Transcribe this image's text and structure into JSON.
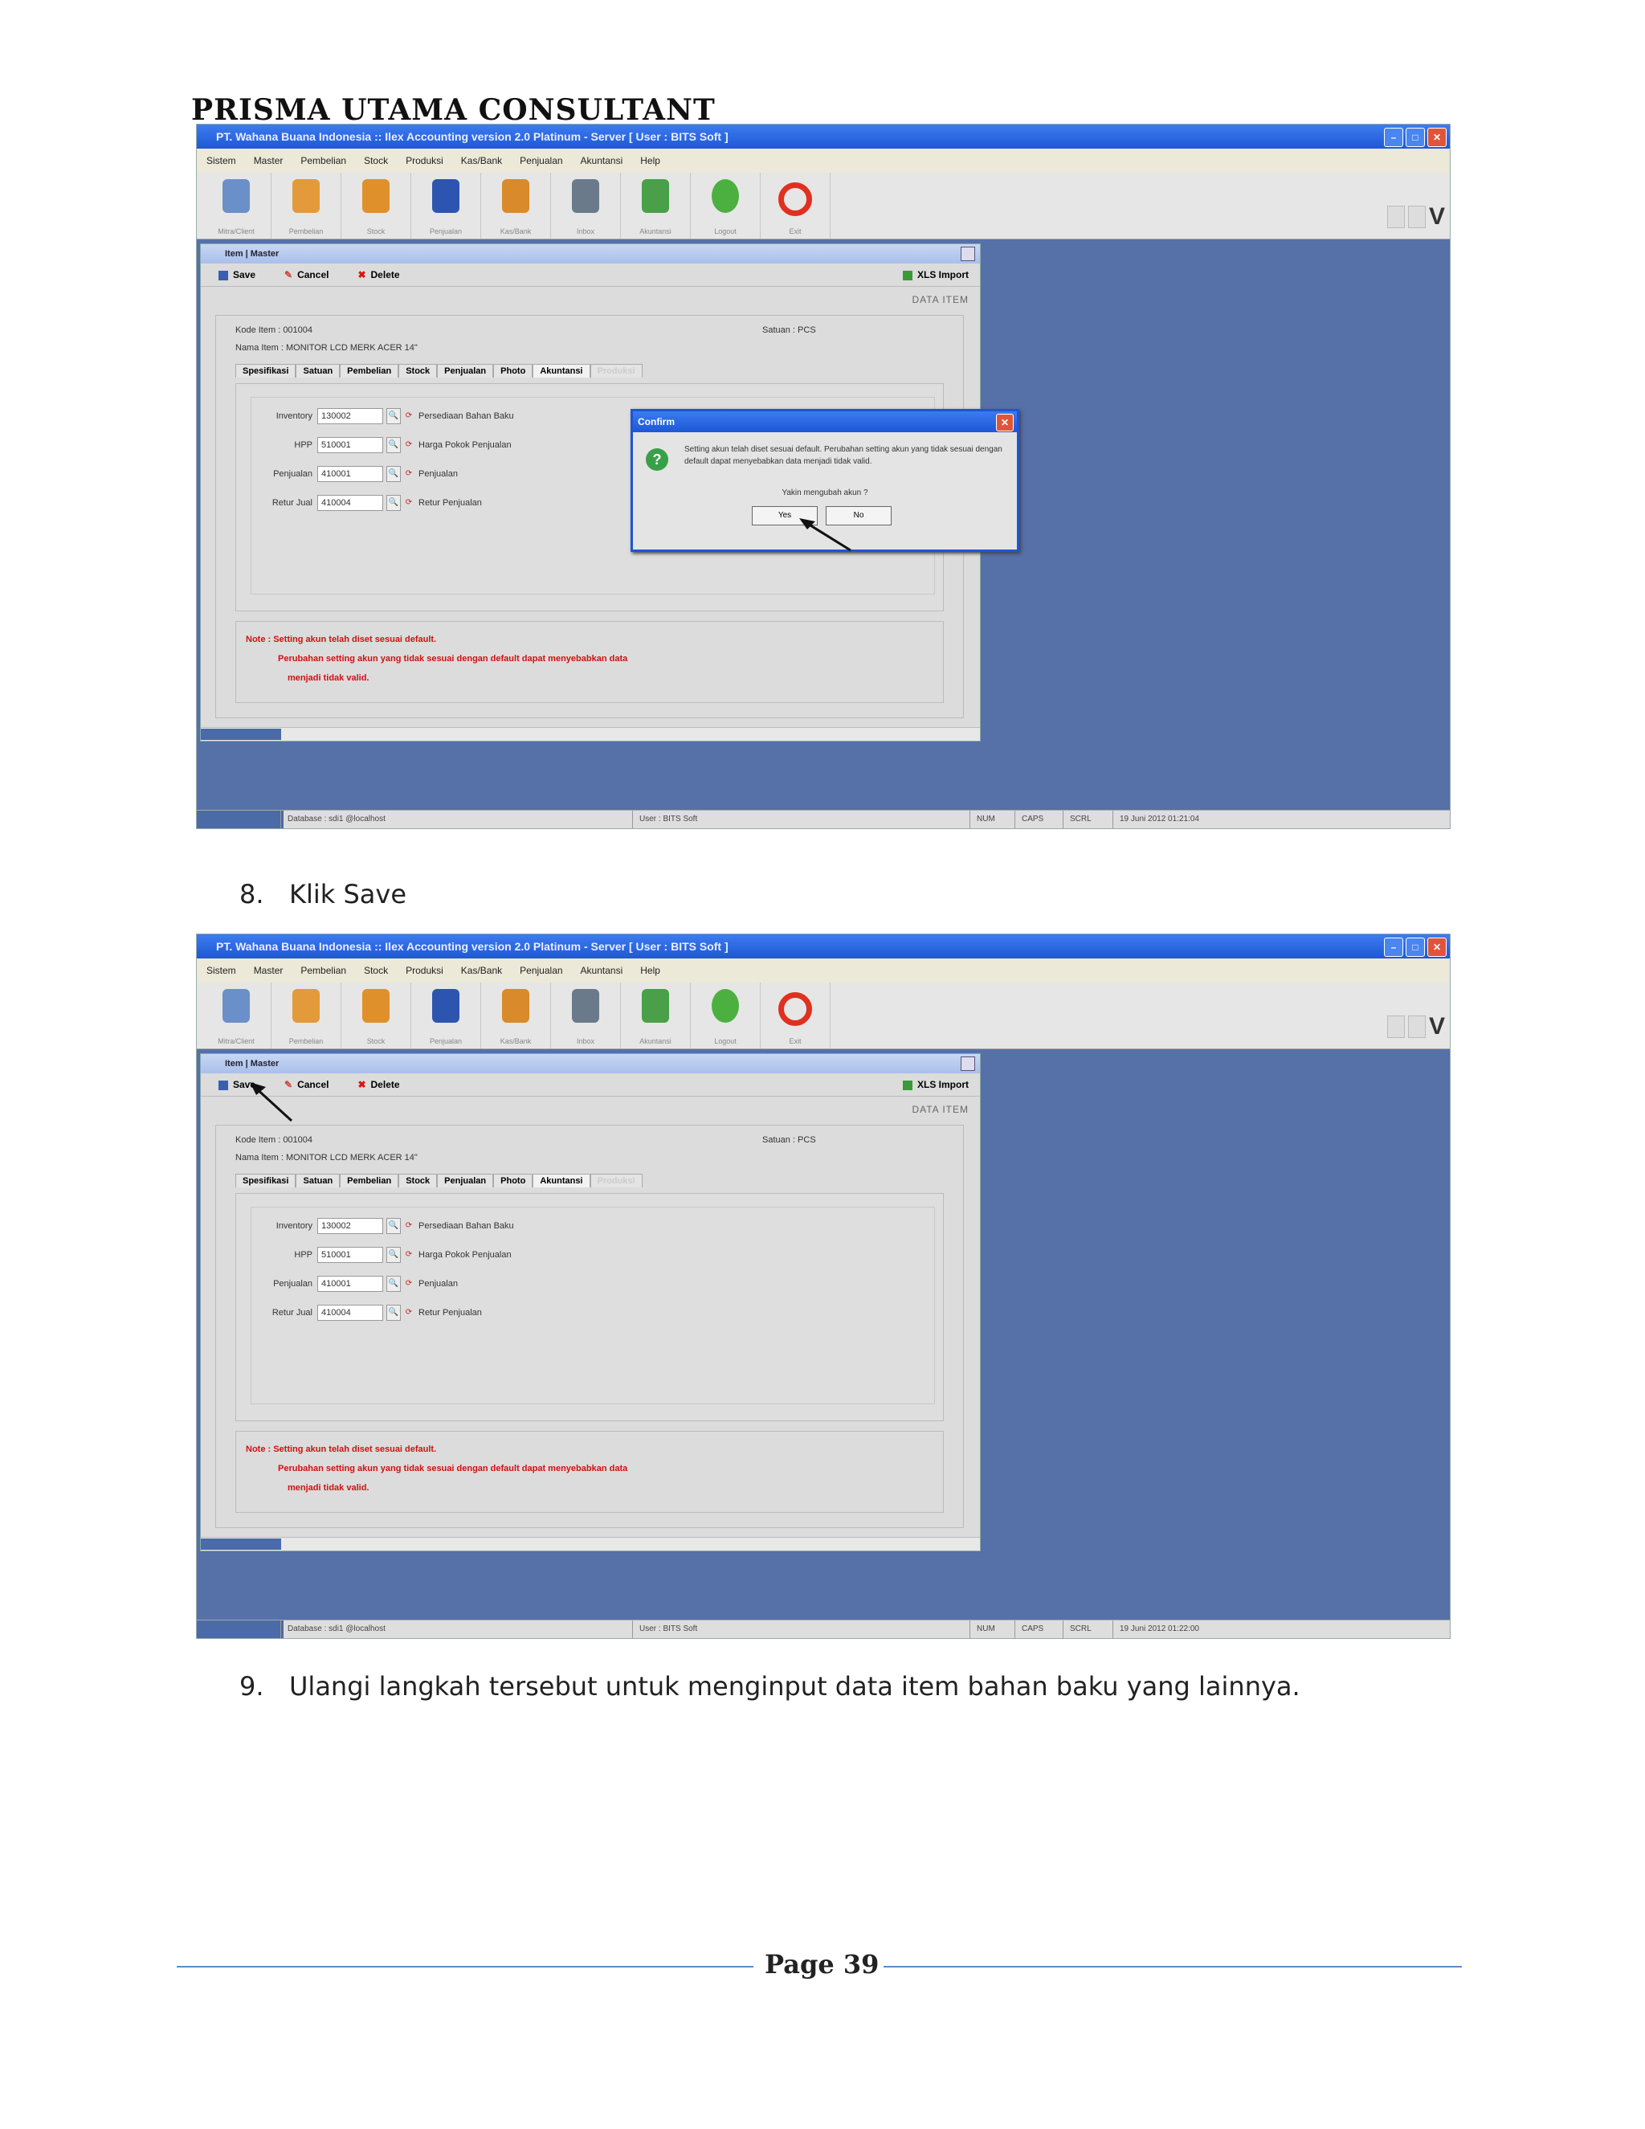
{
  "document": {
    "header": "PRISMA UTAMA CONSULTANT",
    "footer_label": "Page 39",
    "steps": [
      {
        "number": "8.",
        "text": "Klik Save"
      },
      {
        "number": "9.",
        "text": "Ulangi langkah tersebut untuk menginput data item bahan baku yang lainnya."
      }
    ]
  },
  "app": {
    "window_title": "PT. Wahana Buana Indonesia :: Ilex Accounting version 2.0 Platinum - Server [ User : BITS Soft ]",
    "menu": [
      "Sistem",
      "Master",
      "Pembelian",
      "Stock",
      "Produksi",
      "Kas/Bank",
      "Penjualan",
      "Akuntansi",
      "Help"
    ],
    "toolbar": [
      {
        "label": "Mitra/Client",
        "icon": "users-icon",
        "color": "#6b8fc8"
      },
      {
        "label": "Pembelian",
        "icon": "purchase-icon",
        "color": "#e39a3a"
      },
      {
        "label": "Stock",
        "icon": "box-icon",
        "color": "#e0902a"
      },
      {
        "label": "Penjualan",
        "icon": "bag-icon",
        "color": "#2d55b0"
      },
      {
        "label": "Kas/Bank",
        "icon": "cash-icon",
        "color": "#d98a2a"
      },
      {
        "label": "Inbox",
        "icon": "cart-icon",
        "color": "#6a7a8a"
      },
      {
        "label": "Akuntansi",
        "icon": "chart-icon",
        "color": "#4aa048"
      },
      {
        "label": "Logout",
        "icon": "logout-icon",
        "color": "#4cb040"
      },
      {
        "label": "Exit",
        "icon": "power-icon",
        "color": "#e03020"
      }
    ],
    "form": {
      "title": "Item | Master",
      "save": "Save",
      "cancel": "Cancel",
      "delete": "Delete",
      "import": "XLS Import",
      "section": "DATA ITEM",
      "kode_label": "Kode Item",
      "kode_value": "001004",
      "nama_label": "Nama Item",
      "nama_value": "MONITOR LCD MERK ACER 14\"",
      "satuan_label": "Satuan",
      "satuan_value": "PCS",
      "tabs": [
        "Spesifikasi",
        "Satuan",
        "Pembelian",
        "Stock",
        "Penjualan",
        "Photo",
        "Akuntansi",
        "Produksi"
      ],
      "rows": [
        {
          "label": "Inventory",
          "value": "130002",
          "desc": "Persediaan Bahan Baku"
        },
        {
          "label": "HPP",
          "value": "510001",
          "desc": "Harga Pokok Penjualan"
        },
        {
          "label": "Penjualan",
          "value": "410001",
          "desc": "Penjualan"
        },
        {
          "label": "Retur Jual",
          "value": "410004",
          "desc": "Retur Penjualan"
        }
      ],
      "note_line1": "Note : Setting akun telah diset sesuai default.",
      "note_line2": "Perubahan setting akun yang tidak sesuai dengan default dapat menyebabkan data",
      "note_line3": "menjadi tidak valid."
    },
    "dialog": {
      "title": "Confirm",
      "message": "Setting akun telah diset sesuai default. Perubahan setting akun yang tidak sesuai dengan default dapat menyebabkan data menjadi tidak valid.",
      "question": "Yakin mengubah akun ?",
      "yes": "Yes",
      "no": "No"
    },
    "status": {
      "database": "Database : sdi1 @localhost",
      "user": "User : BITS Soft",
      "num": "NUM",
      "caps": "CAPS",
      "scrl": "SCRL",
      "datetime_1": "19 Juni 2012  01:21:04",
      "datetime_2": "19 Juni 2012  01:22:00"
    }
  }
}
